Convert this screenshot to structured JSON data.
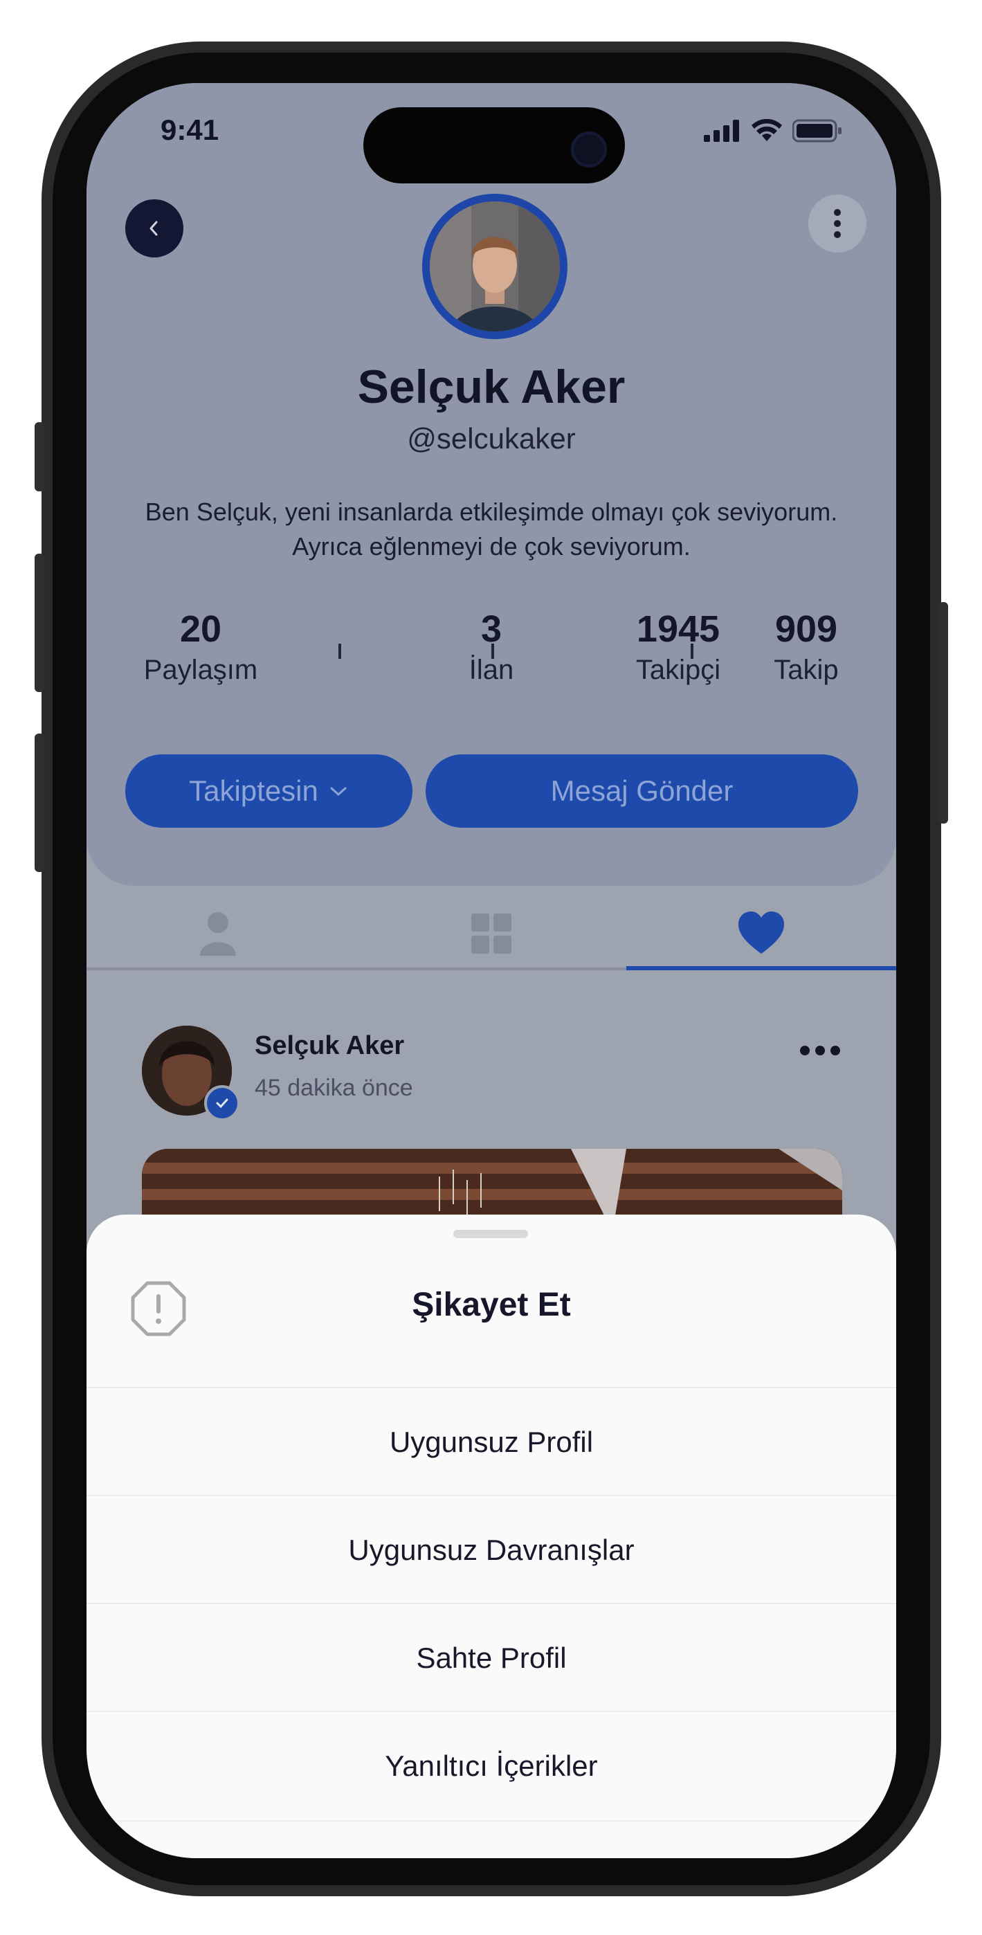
{
  "status": {
    "time": "9:41"
  },
  "profile": {
    "name": "Selçuk Aker",
    "handle": "@selcukaker",
    "bio_line1": "Ben Selçuk, yeni insanlarda etkileşimde olmayı çok seviyorum.",
    "bio_line2": "Ayrıca eğlenmeyi de çok seviyorum.",
    "stats": [
      {
        "value": "20",
        "label": "Paylaşım"
      },
      {
        "value": "3",
        "label": "İlan"
      },
      {
        "value": "1945",
        "label": "Takipçi"
      },
      {
        "value": "909",
        "label": "Takip"
      }
    ],
    "follow_button": "Takiptesin",
    "message_button": "Mesaj Gönder"
  },
  "tabs": {
    "icons": [
      "person-icon",
      "grid-icon",
      "heart-icon"
    ],
    "active": "heart-icon"
  },
  "post": {
    "author": "Selçuk Aker",
    "time": "45 dakika önce"
  },
  "sheet": {
    "title": "Şikayet Et",
    "options": [
      "Uygunsuz Profil",
      "Uygunsuz Davranışlar",
      "Sahte Profil",
      "Yanıltıcı İçerikler"
    ]
  },
  "colors": {
    "accent": "#1e4aab",
    "overlay": "#8f96aa",
    "sheet": "#fafafa"
  }
}
